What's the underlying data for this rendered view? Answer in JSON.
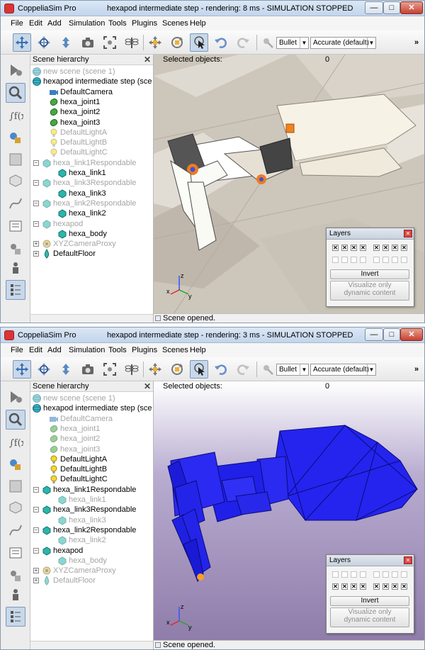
{
  "app_name": "CoppeliaSim Pro",
  "window_controls": {
    "minimize": "—",
    "maximize": "□",
    "close": "✕"
  },
  "menu": [
    "File",
    "Edit",
    "Add",
    "Simulation",
    "Tools",
    "Plugins",
    "Scenes",
    "Help"
  ],
  "toolbar": {
    "engine": "Bullet",
    "accuracy": "Accurate (default)",
    "more": "»",
    "icons": [
      "camera-pan-icon",
      "camera-rotate-icon",
      "camera-shift-icon",
      "camera-angle-icon",
      "fit-to-view-icon",
      "dragonfly-icon",
      "object-shift-icon",
      "object-rotate-icon",
      "click-select-icon",
      "undo-icon",
      "redo-icon",
      "dynamics-settings-icon"
    ]
  },
  "left_toolbar_icons": [
    "simulation-settings-icon",
    "scene-object-properties-icon",
    "calculation-module-icon",
    "collections-icon",
    "scripts-icon",
    "shapes-edit-icon",
    "path-edit-icon",
    "selection-icon",
    "model-browser-icon",
    "scene-hierarchy-icon",
    "layers-icon"
  ],
  "hierarchy": {
    "title": "Scene hierarchy",
    "close": "✕"
  },
  "windows": [
    {
      "title": "hexapod intermediate step - rendering: 8 ms - SIMULATION STOPPED",
      "selected_label": "Selected objects:",
      "selected_count": "0",
      "status": "Scene opened.",
      "tree": [
        {
          "label": "new scene (scene 1)",
          "dim": true,
          "icon": "scene-icon",
          "expander": "",
          "depth": 0
        },
        {
          "label": "hexapod intermediate step (scene",
          "dim": false,
          "icon": "scene-icon",
          "expander": "",
          "depth": 0
        },
        {
          "label": "DefaultCamera",
          "dim": false,
          "icon": "camera-icon",
          "expander": "",
          "depth": 2
        },
        {
          "label": "hexa_joint1",
          "dim": false,
          "icon": "joint-icon",
          "expander": "",
          "depth": 2
        },
        {
          "label": "hexa_joint2",
          "dim": false,
          "icon": "joint-icon",
          "expander": "",
          "depth": 2
        },
        {
          "label": "hexa_joint3",
          "dim": false,
          "icon": "joint-icon",
          "expander": "",
          "depth": 2
        },
        {
          "label": "DefaultLightA",
          "dim": true,
          "icon": "light-icon",
          "expander": "",
          "depth": 2
        },
        {
          "label": "DefaultLightB",
          "dim": true,
          "icon": "light-icon",
          "expander": "",
          "depth": 2
        },
        {
          "label": "DefaultLightC",
          "dim": true,
          "icon": "light-icon",
          "expander": "",
          "depth": 2
        },
        {
          "label": "hexa_link1Respondable",
          "dim": true,
          "icon": "shape-icon",
          "expander": "−",
          "depth": 1
        },
        {
          "label": "hexa_link1",
          "dim": false,
          "icon": "shape-icon",
          "expander": "",
          "depth": 3
        },
        {
          "label": "hexa_link3Respondable",
          "dim": true,
          "icon": "shape-icon",
          "expander": "−",
          "depth": 1
        },
        {
          "label": "hexa_link3",
          "dim": false,
          "icon": "shape-icon",
          "expander": "",
          "depth": 3
        },
        {
          "label": "hexa_link2Respondable",
          "dim": true,
          "icon": "shape-icon",
          "expander": "−",
          "depth": 1
        },
        {
          "label": "hexa_link2",
          "dim": false,
          "icon": "shape-icon",
          "expander": "",
          "depth": 3
        },
        {
          "label": "hexapod",
          "dim": true,
          "icon": "shape-icon",
          "expander": "−",
          "depth": 1
        },
        {
          "label": "hexa_body",
          "dim": false,
          "icon": "shape-icon",
          "expander": "",
          "depth": 3
        },
        {
          "label": "XYZCameraProxy",
          "dim": true,
          "icon": "proxy-icon",
          "expander": "+",
          "depth": 1
        },
        {
          "label": "DefaultFloor",
          "dim": false,
          "icon": "floor-icon",
          "expander": "+",
          "depth": 1
        }
      ],
      "layers": {
        "title": "Layers",
        "row1": [
          "x",
          "x",
          "x",
          "x",
          "x",
          "x",
          "x",
          "x"
        ],
        "row2": [
          "",
          "",
          "",
          "",
          "",
          "",
          "",
          ""
        ],
        "invert": "Invert",
        "visualize_line1": "Visualize only",
        "visualize_line2": "dynamic content"
      }
    },
    {
      "title": "hexapod intermediate step - rendering: 3 ms - SIMULATION STOPPED",
      "selected_label": "Selected objects:",
      "selected_count": "0",
      "status": "Scene opened.",
      "tree": [
        {
          "label": "new scene (scene 1)",
          "dim": true,
          "icon": "scene-icon",
          "expander": "",
          "depth": 0
        },
        {
          "label": "hexapod intermediate step (scene",
          "dim": false,
          "icon": "scene-icon",
          "expander": "",
          "depth": 0
        },
        {
          "label": "DefaultCamera",
          "dim": true,
          "icon": "camera-icon",
          "expander": "",
          "depth": 2
        },
        {
          "label": "hexa_joint1",
          "dim": true,
          "icon": "joint-icon",
          "expander": "",
          "depth": 2
        },
        {
          "label": "hexa_joint2",
          "dim": true,
          "icon": "joint-icon",
          "expander": "",
          "depth": 2
        },
        {
          "label": "hexa_joint3",
          "dim": true,
          "icon": "joint-icon",
          "expander": "",
          "depth": 2
        },
        {
          "label": "DefaultLightA",
          "dim": false,
          "icon": "light-icon",
          "expander": "",
          "depth": 2
        },
        {
          "label": "DefaultLightB",
          "dim": false,
          "icon": "light-icon",
          "expander": "",
          "depth": 2
        },
        {
          "label": "DefaultLightC",
          "dim": false,
          "icon": "light-icon",
          "expander": "",
          "depth": 2
        },
        {
          "label": "hexa_link1Respondable",
          "dim": false,
          "icon": "shape-icon",
          "expander": "−",
          "depth": 1
        },
        {
          "label": "hexa_link1",
          "dim": true,
          "icon": "shape-icon",
          "expander": "",
          "depth": 3
        },
        {
          "label": "hexa_link3Respondable",
          "dim": false,
          "icon": "shape-icon",
          "expander": "−",
          "depth": 1
        },
        {
          "label": "hexa_link3",
          "dim": true,
          "icon": "shape-icon",
          "expander": "",
          "depth": 3
        },
        {
          "label": "hexa_link2Respondable",
          "dim": false,
          "icon": "shape-icon",
          "expander": "−",
          "depth": 1
        },
        {
          "label": "hexa_link2",
          "dim": true,
          "icon": "shape-icon",
          "expander": "",
          "depth": 3
        },
        {
          "label": "hexapod",
          "dim": false,
          "icon": "shape-icon",
          "expander": "−",
          "depth": 1
        },
        {
          "label": "hexa_body",
          "dim": true,
          "icon": "shape-icon",
          "expander": "",
          "depth": 3
        },
        {
          "label": "XYZCameraProxy",
          "dim": true,
          "icon": "proxy-icon",
          "expander": "+",
          "depth": 1
        },
        {
          "label": "DefaultFloor",
          "dim": true,
          "icon": "floor-icon",
          "expander": "+",
          "depth": 1
        }
      ],
      "layers": {
        "title": "Layers",
        "row1": [
          "",
          "",
          "",
          "",
          "",
          "",
          "",
          ""
        ],
        "row2": [
          "x",
          "x",
          "x",
          "x",
          "x",
          "x",
          "x",
          "x"
        ],
        "invert": "Invert",
        "visualize_line1": "Visualize only",
        "visualize_line2": "dynamic content"
      }
    }
  ],
  "axes": {
    "x": "x",
    "y": "y",
    "z": "z"
  },
  "colors": {
    "dynamic_shape": "#2222ee",
    "joint_icon": "#3a9a3a",
    "shape_icon": "#26b0a8",
    "light_icon": "#f2d21a",
    "selection_bg": "#c8d8ea",
    "close_red": "#c84030"
  }
}
